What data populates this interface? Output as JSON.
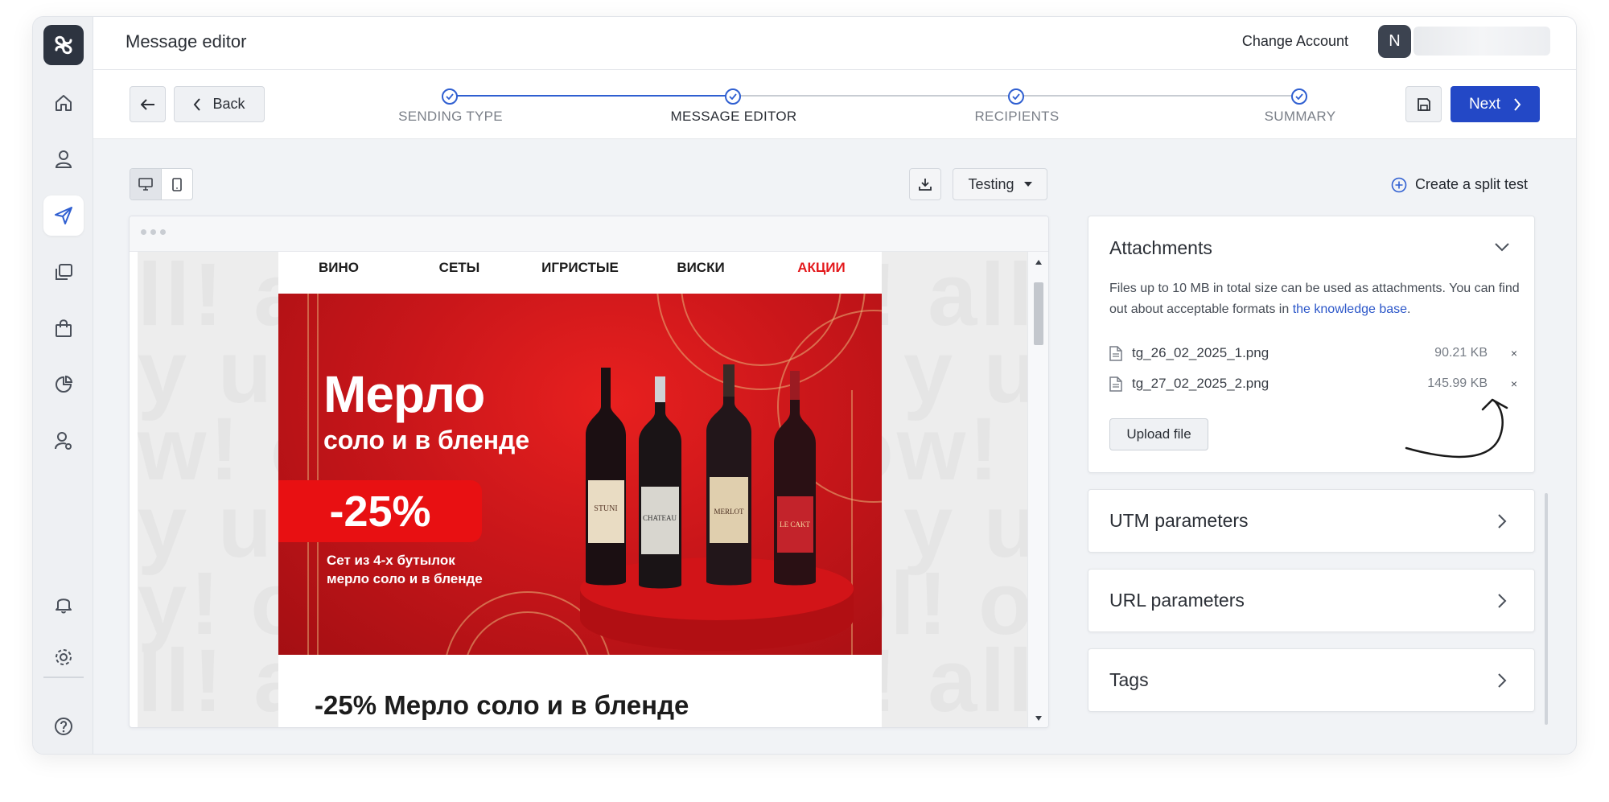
{
  "header": {
    "title": "Message editor",
    "change_account": "Change Account",
    "avatar_initial": "N"
  },
  "sidebar": {
    "items": [
      {
        "icon": "home-icon"
      },
      {
        "icon": "contacts-icon"
      },
      {
        "icon": "campaigns-send-icon",
        "active": true
      },
      {
        "icon": "templates-icon"
      },
      {
        "icon": "ecommerce-bag-icon"
      },
      {
        "icon": "analytics-pie-icon"
      },
      {
        "icon": "user-settings-icon"
      },
      {
        "icon": "notifications-bell-icon"
      },
      {
        "icon": "settings-gear-icon"
      },
      {
        "icon": "help-icon"
      }
    ]
  },
  "toolbar": {
    "back_label": "Back",
    "next_label": "Next",
    "steps": [
      {
        "label": "SENDING TYPE",
        "done": true
      },
      {
        "label": "MESSAGE EDITOR",
        "done": true,
        "current": true
      },
      {
        "label": "RECIPIENTS",
        "done": true
      },
      {
        "label": "SUMMARY",
        "done": true
      }
    ]
  },
  "editor": {
    "testing_label": "Testing",
    "split_test_label": "Create a split test"
  },
  "email_preview": {
    "nav": [
      "ВИНО",
      "СЕТЫ",
      "ИГРИСТЫЕ",
      "ВИСКИ",
      "АКЦИИ"
    ],
    "banner_title": "Мерло",
    "banner_subtitle": "соло и в бленде",
    "banner_badge": "-25%",
    "banner_desc_line1": "Сет из 4-х бутылок",
    "banner_desc_line2": "мерло соло и в бленде",
    "heading": "-25% Мерло соло и в бленде",
    "bottle_labels": [
      "STUNI",
      "CHATEAU",
      "MERLOT",
      "LE CAKT"
    ]
  },
  "attachments": {
    "title": "Attachments",
    "desc_text": "Files up to 10 MB in total size can be used as attachments. You can find out about acceptable formats in ",
    "desc_link": "the knowledge base",
    "desc_end": ".",
    "files": [
      {
        "name": "tg_26_02_2025_1.png",
        "size": "90.21 KB"
      },
      {
        "name": "tg_27_02_2025_2.png",
        "size": "145.99 KB"
      }
    ],
    "upload_label": "Upload file",
    "remove_symbol": "×"
  },
  "panels": {
    "utm": "UTM parameters",
    "url": "URL parameters",
    "tags": "Tags"
  },
  "colors": {
    "primary": "#2348c6",
    "step_accent": "#2f5fd1",
    "promo_red": "#e3191c",
    "banner_red": "#c9161a"
  }
}
